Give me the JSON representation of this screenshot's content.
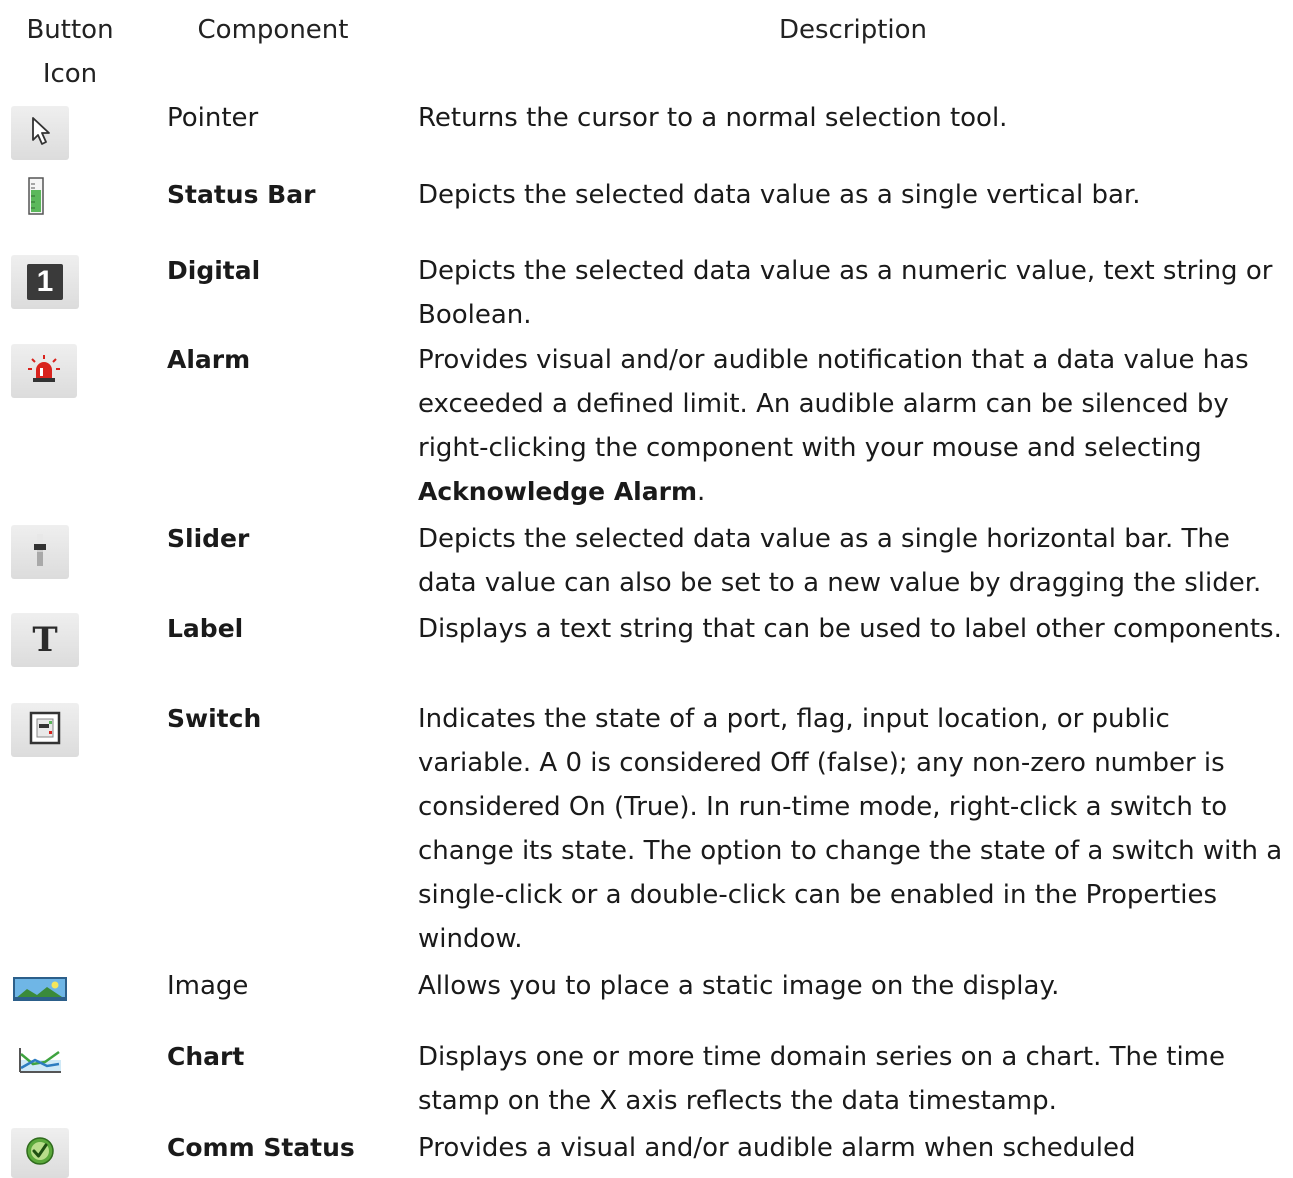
{
  "header": {
    "icon_col": "Button\nIcon",
    "icon_col_line1": "Button",
    "icon_col_line2": "Icon",
    "component_col": "Component",
    "description_col": "Description"
  },
  "rows": [
    {
      "icon": "pointer-icon",
      "component": "Pointer",
      "description": "Returns the cursor to a normal selection tool."
    },
    {
      "icon": "status-bar-icon",
      "component": "Status Bar",
      "description": "Depicts the selected data value as a single vertical bar."
    },
    {
      "icon": "digital-icon",
      "icon_text": "1",
      "component": "Digital",
      "description": "Depicts the selected data value as a numeric value, text string or Boolean."
    },
    {
      "icon": "alarm-icon",
      "component": "Alarm",
      "description_part1": "Provides visual and/or audible notification that a data value has exceeded a defined limit. An audible alarm can be silenced by right-clicking the component with your mouse and selecting ",
      "description_bold": "Acknowledge Alarm",
      "description_part2": "."
    },
    {
      "icon": "slider-icon",
      "component": "Slider",
      "description": "Depicts the selected data value as a single horizontal bar. The data value can also be set to a new value by dragging the slider."
    },
    {
      "icon": "label-icon",
      "icon_text": "T",
      "component": "Label",
      "description": "Displays a text string that can be used to label other components."
    },
    {
      "icon": "switch-icon",
      "component": "Switch",
      "description": "Indicates the state of a port, flag, input location, or public variable. A 0 is considered Off (false); any non-zero number is considered On (True). In run-time mode, right-click a switch to change its state. The option to change the state of a switch with a single-click or a double-click can be enabled in the Properties window."
    },
    {
      "icon": "image-icon",
      "component": "Image",
      "description": "Allows you to place a static image on the display."
    },
    {
      "icon": "chart-icon",
      "component": "Chart",
      "description": "Displays one or more time domain series on a chart. The time stamp on the X axis reflects the data timestamp."
    },
    {
      "icon": "comm-status-icon",
      "component": "Comm Status",
      "description": "Provides a visual and/or audible alarm when scheduled"
    }
  ],
  "colors": {
    "text": "#1a1a1a",
    "icon_bg": "#e4e4e4",
    "status_green": "#5cb85c",
    "alarm_red": "#d9231d",
    "comm_green": "#3d9a2e"
  }
}
